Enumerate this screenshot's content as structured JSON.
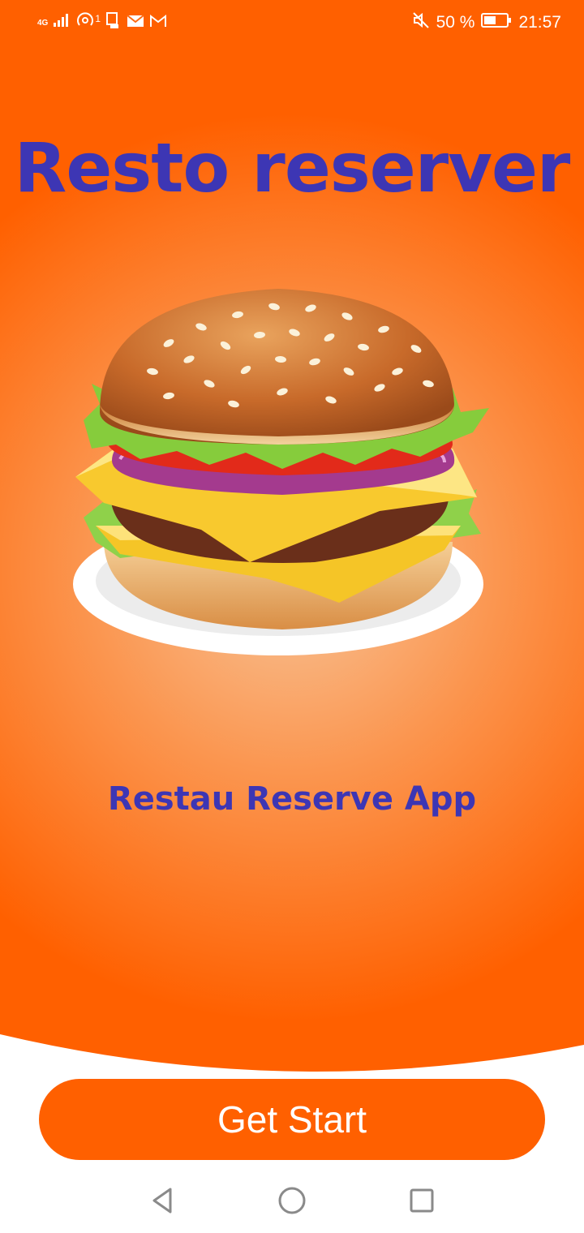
{
  "status_bar": {
    "network": "4G",
    "sim_indicator": "1",
    "battery": "50 %",
    "time": "21:57",
    "icons": [
      "signal-icon",
      "hotspot-icon",
      "sim-icon",
      "mail-icon",
      "gmail-icon",
      "mute-icon",
      "battery-icon"
    ]
  },
  "app": {
    "title": "Resto reserver",
    "subtitle": "Restau Reserve App",
    "hero_image": "burger-illustration"
  },
  "actions": {
    "primary_button": "Get Start"
  },
  "colors": {
    "accent": "#ff6000",
    "title": "#3d36b4",
    "background_center": "#f7c59a"
  },
  "nav": [
    "back-icon",
    "home-icon",
    "recents-icon"
  ]
}
